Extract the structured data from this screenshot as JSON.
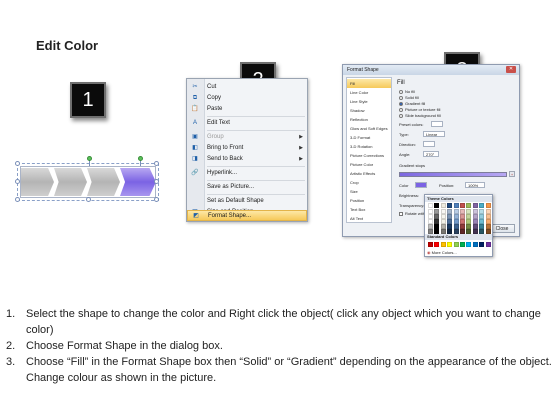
{
  "title": "Edit Color",
  "steps": {
    "one": "1",
    "two": "2",
    "three": "3"
  },
  "colors": {
    "accent_purple": "#7b63e4",
    "menu_highlight": "#f6c95a",
    "step_box": "#0b0b0b"
  },
  "context_menu": {
    "items": [
      {
        "icon": "scissors-icon",
        "glyph": "✂",
        "label": "Cut",
        "disabled": false
      },
      {
        "icon": "copy-icon",
        "glyph": "⧉",
        "label": "Copy",
        "disabled": false
      },
      {
        "icon": "paste-icon",
        "glyph": "📋",
        "label": "Paste",
        "disabled": false
      },
      {
        "icon": "edit-text-icon",
        "glyph": "A",
        "label": "Edit Text",
        "disabled": false
      },
      {
        "icon": "group-icon",
        "glyph": "▣",
        "label": "Group",
        "disabled": true,
        "submenu": true
      },
      {
        "icon": "bring-to-front-icon",
        "glyph": "◧",
        "label": "Bring to Front",
        "disabled": false,
        "submenu": true
      },
      {
        "icon": "send-to-back-icon",
        "glyph": "◨",
        "label": "Send to Back",
        "disabled": false,
        "submenu": true
      },
      {
        "icon": "hyperlink-icon",
        "glyph": "🔗",
        "label": "Hyperlink...",
        "disabled": false
      },
      {
        "icon": "save-picture-icon",
        "glyph": "",
        "label": "Save as Picture...",
        "disabled": false
      },
      {
        "icon": "default-shape-icon",
        "glyph": "",
        "label": "Set as Default Shape",
        "disabled": false
      },
      {
        "icon": "size-position-icon",
        "glyph": "▦",
        "label": "Size and Position...",
        "disabled": false
      },
      {
        "icon": "format-shape-icon",
        "glyph": "◩",
        "label": "Format Shape...",
        "disabled": false,
        "highlight": true
      }
    ]
  },
  "format_dialog": {
    "title": "Format Shape",
    "close_label": "Close",
    "nav": [
      "Fill",
      "Line Color",
      "Line Style",
      "Shadow",
      "Reflection",
      "Glow and Soft Edges",
      "3-D Format",
      "3-D Rotation",
      "Picture Corrections",
      "Picture Color",
      "Artistic Effects",
      "Crop",
      "Size",
      "Position",
      "Text Box",
      "Alt Text"
    ],
    "fill_heading": "Fill",
    "fill_options": [
      "No fill",
      "Solid fill",
      "Gradient fill",
      "Picture or texture fill",
      "Slide background fill"
    ],
    "selected_fill": "Gradient fill",
    "preset_colors_label": "Preset colors:",
    "type_label": "Type:",
    "type_value": "Linear",
    "direction_label": "Direction:",
    "angle_label": "Angle:",
    "angle_value": "270°",
    "gradient_stops_label": "Gradient stops",
    "color_label": "Color",
    "position_label": "Position:",
    "position_value": "100%",
    "brightness_label": "Brightness:",
    "transparency_label": "Transparency:",
    "rotate_label": "Rotate with shape"
  },
  "color_popup": {
    "theme_label": "Theme Colors",
    "standard_label": "Standard Colors",
    "more_label": "More Colors...",
    "theme_row": [
      "#ffffff",
      "#000000",
      "#eeece1",
      "#1f497d",
      "#4f81bd",
      "#c0504d",
      "#9bbb59",
      "#8064a2",
      "#4bacc6",
      "#f79646"
    ],
    "standard_row": [
      "#c00000",
      "#ff0000",
      "#ffc000",
      "#ffff00",
      "#92d050",
      "#00b050",
      "#00b0f0",
      "#0070c0",
      "#002060",
      "#7030a0"
    ]
  },
  "instructions": [
    {
      "num": "1.",
      "text": "Select the shape to change the color and Right click the object( click any object which you want to change color)"
    },
    {
      "num": "2.",
      "text": "Choose Format Shape in the dialog box."
    },
    {
      "num": "3.",
      "text": "Choose “Fill” in the Format Shape box then “Solid” or “Gradient” depending on the appearance of the object. Change colour as shown in the picture."
    }
  ]
}
